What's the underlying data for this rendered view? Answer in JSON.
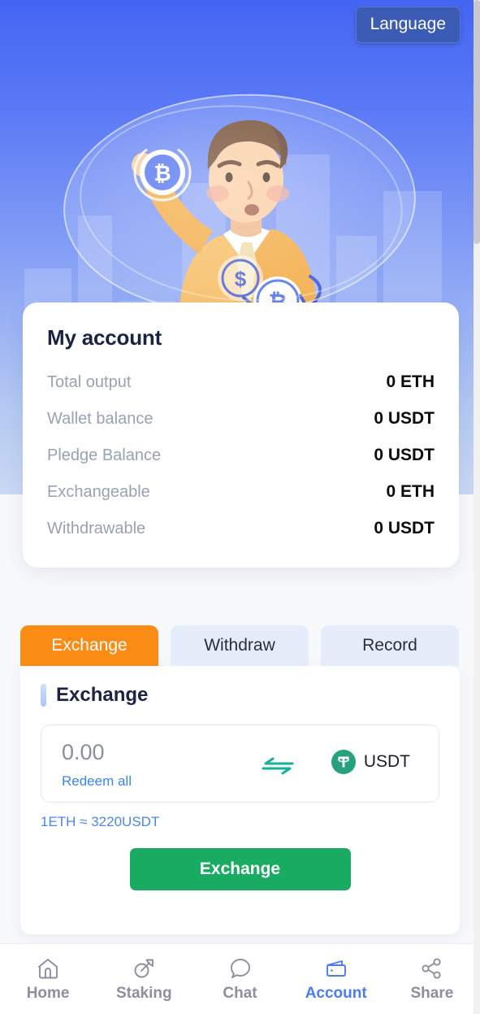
{
  "header": {
    "language_button": "Language",
    "gradient_top": "#4465f3",
    "gradient_bottom": "#c9d8f3",
    "illustration_alt": "man-holding-bitcoin-illustration"
  },
  "account_card": {
    "title": "My account",
    "rows": [
      {
        "label": "Total output",
        "value": "0 ETH"
      },
      {
        "label": "Wallet balance",
        "value": "0 USDT"
      },
      {
        "label": "Pledge Balance",
        "value": "0 USDT"
      },
      {
        "label": "Exchangeable",
        "value": "0 ETH"
      },
      {
        "label": "Withdrawable",
        "value": "0 USDT"
      }
    ]
  },
  "tabs": [
    {
      "label": "Exchange",
      "active": true
    },
    {
      "label": "Withdraw",
      "active": false
    },
    {
      "label": "Record",
      "active": false
    }
  ],
  "exchange_panel": {
    "section_title": "Exchange",
    "amount_value": "",
    "amount_placeholder": "0.00",
    "redeem_all_label": "Redeem all",
    "swap_icon_name": "swap-arrows-icon",
    "coin_symbol": "USDT",
    "coin_logo_name": "tether-logo-icon",
    "rate_text": "1ETH ≈ 3220USDT",
    "submit_label": "Exchange"
  },
  "bottom_nav": [
    {
      "label": "Home",
      "icon": "home-icon",
      "active": false
    },
    {
      "label": "Staking",
      "icon": "shovel-icon",
      "active": false
    },
    {
      "label": "Chat",
      "icon": "chat-icon",
      "active": false
    },
    {
      "label": "Account",
      "icon": "wallet-icon",
      "active": true
    },
    {
      "label": "Share",
      "icon": "share-icon",
      "active": false
    }
  ],
  "colors": {
    "accent_orange": "#fa8c16",
    "accent_green": "#1aab63",
    "accent_blue": "#4a7df5",
    "tether_green": "#26a17b",
    "link_blue": "#3a86f7"
  }
}
